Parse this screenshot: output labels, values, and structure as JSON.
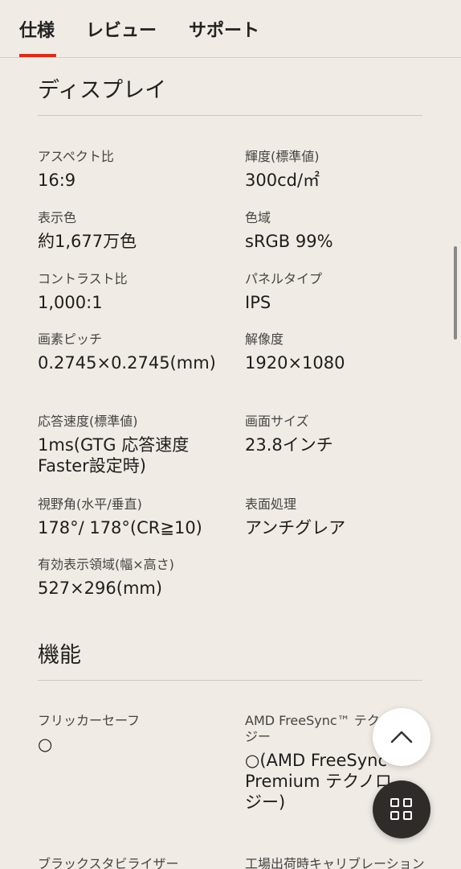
{
  "tabs": [
    {
      "label": "仕様",
      "active": true
    },
    {
      "label": "レビュー",
      "active": false
    },
    {
      "label": "サポート",
      "active": false
    }
  ],
  "display_section": {
    "title": "ディスプレイ",
    "specs": [
      {
        "label": "アスペクト比",
        "value": "16:9"
      },
      {
        "label": "輝度(標準値)",
        "value": "300cd/㎡"
      },
      {
        "label": "表示色",
        "value": "約1,677万色"
      },
      {
        "label": "色域",
        "value": "sRGB 99%"
      },
      {
        "label": "コントラスト比",
        "value": "1,000:1"
      },
      {
        "label": "パネルタイプ",
        "value": "IPS"
      },
      {
        "label": "画素ピッチ",
        "value": "0.2745×0.2745(mm)"
      },
      {
        "label": "解像度",
        "value": "1920×1080"
      },
      {
        "label": "応答速度(標準値)",
        "value": "1ms(GTG 応答速度Faster設定時)"
      },
      {
        "label": "画面サイズ",
        "value": "23.8インチ"
      },
      {
        "label": "視野角(水平/垂直)",
        "value": "178°/ 178°(CR≧10)"
      },
      {
        "label": "表面処理",
        "value": "アンチグレア"
      },
      {
        "label": "有効表示領域(幅×高さ)",
        "value": "527×296(mm)"
      }
    ]
  },
  "features_section": {
    "title": "機能",
    "specs": [
      {
        "label": "フリッカーセーフ",
        "value": "○"
      },
      {
        "label": "AMD FreeSync™ テクノロジー",
        "value": "○(AMD FreeSync™ Premium テクノロジー)"
      }
    ],
    "next_row": [
      "ブラックスタビライザー",
      "工場出荷時キャリブレーション"
    ]
  },
  "buttons": {
    "scroll_top_icon": "chevron-up-icon",
    "menu_icon": "grid-icon"
  },
  "colors": {
    "background": "#f0ebe4",
    "accent": "#d22f1f",
    "fab_dark": "#2e2b29"
  }
}
